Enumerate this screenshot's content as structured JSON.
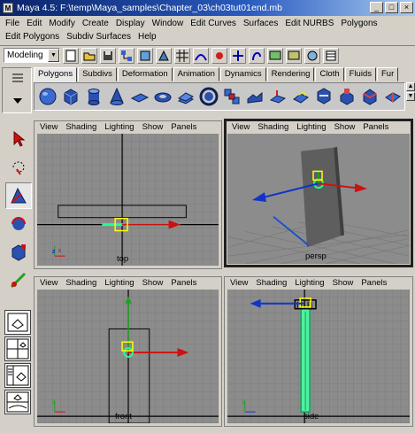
{
  "window": {
    "app_icon_letter": "M",
    "title": "Maya 4.5: F:\\temp\\Maya_samples\\Chapter_03\\ch03tut01end.mb",
    "buttons": [
      "_",
      "□",
      "×"
    ]
  },
  "menus": {
    "row1": [
      "File",
      "Edit",
      "Modify",
      "Create",
      "Display",
      "Window",
      "Edit Curves",
      "Surfaces",
      "Edit NURBS",
      "Polygons"
    ],
    "row2": [
      "Edit Polygons",
      "Subdiv Surfaces",
      "Help"
    ]
  },
  "status_line": {
    "mode": "Modeling"
  },
  "shelf": {
    "tabs": [
      "Polygons",
      "Subdivs",
      "Deformation",
      "Animation",
      "Dynamics",
      "Rendering",
      "Cloth",
      "Fluids",
      "Fur"
    ],
    "active_tab": "Polygons",
    "icon_names": [
      "poly-sphere",
      "poly-cube",
      "poly-cylinder",
      "poly-cone",
      "poly-plane",
      "poly-torus",
      "poly-prism",
      "poly-pipe",
      "poly-helix",
      "poly-soccer-ball",
      "poly-platonic",
      "poly-smooth",
      "poly-combine",
      "poly-extrude",
      "poly-bevel",
      "poly-split"
    ]
  },
  "viewports": {
    "menu": [
      "View",
      "Shading",
      "Lighting",
      "Show",
      "Panels"
    ],
    "top": {
      "label": "top"
    },
    "persp": {
      "label": "persp"
    },
    "front": {
      "label": "front"
    },
    "side": {
      "label": "side"
    }
  },
  "colors": {
    "grid_bg": "#8c8c8c",
    "grid_line": "#7a7a7a",
    "axis": "#000000",
    "arrow_x": "#cc1111",
    "arrow_z": "#1133cc",
    "arrow_y": "#11aa11",
    "selection": "#20e080",
    "manip_yellow": "#ffff00"
  }
}
